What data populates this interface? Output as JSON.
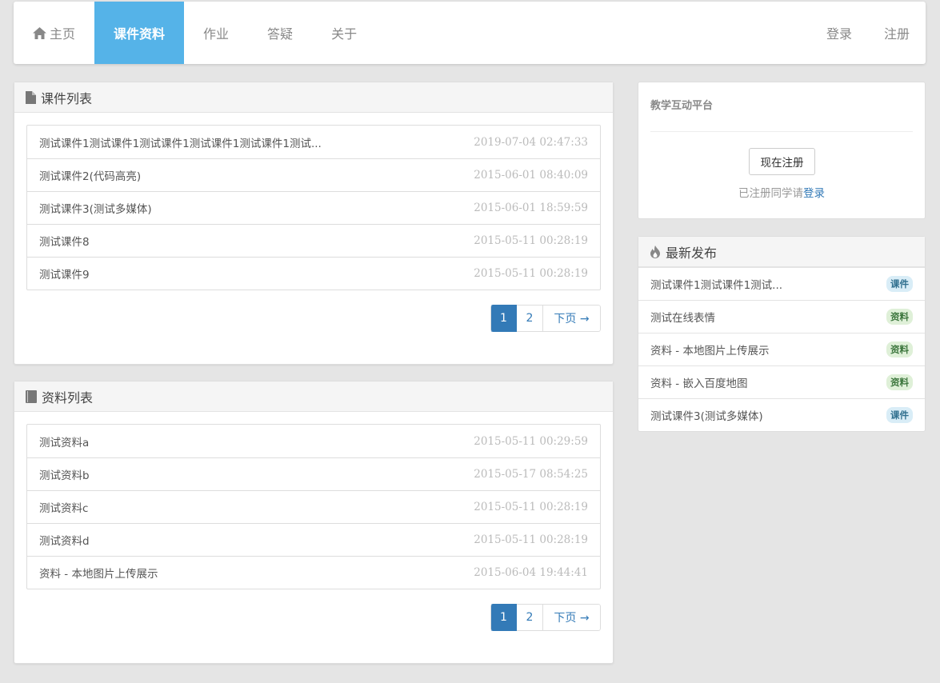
{
  "nav": {
    "items": [
      {
        "label": "主页",
        "icon": "home-icon"
      },
      {
        "label": "课件资料"
      },
      {
        "label": "作业"
      },
      {
        "label": "答疑"
      },
      {
        "label": "关于"
      }
    ],
    "right": [
      {
        "label": "登录"
      },
      {
        "label": "注册"
      }
    ],
    "active_color": "#55b3e8"
  },
  "courseware": {
    "title": "课件列表",
    "icon": "file-icon",
    "rows": [
      {
        "title": "测试课件1测试课件1测试课件1测试课件1测试课件1测试...",
        "date": "2019-07-04 02:47:33"
      },
      {
        "title": "测试课件2(代码高亮)",
        "date": "2015-06-01 08:40:09"
      },
      {
        "title": "测试课件3(测试多媒体)",
        "date": "2015-06-01 18:59:59"
      },
      {
        "title": "测试课件8",
        "date": "2015-05-11 00:28:19"
      },
      {
        "title": "测试课件9",
        "date": "2015-05-11 00:28:19"
      }
    ],
    "pager": {
      "p1": "1",
      "p2": "2",
      "next": "下页 →"
    }
  },
  "materials": {
    "title": "资料列表",
    "icon": "book-icon",
    "rows": [
      {
        "title": "测试资料a",
        "date": "2015-05-11 00:29:59"
      },
      {
        "title": "测试资料b",
        "date": "2015-05-17 08:54:25"
      },
      {
        "title": "测试资料c",
        "date": "2015-05-11 00:28:19"
      },
      {
        "title": "测试资料d",
        "date": "2015-05-11 00:28:19"
      },
      {
        "title": "资料 - 本地图片上传展示",
        "date": "2015-06-04 19:44:41"
      }
    ],
    "pager": {
      "p1": "1",
      "p2": "2",
      "next": "下页 →"
    }
  },
  "sidebar": {
    "brand": "教学互动平台",
    "register_button": "现在注册",
    "hint_text": "已注册同学请",
    "hint_link": "登录"
  },
  "latest": {
    "title": "最新发布",
    "icon": "fire-icon",
    "rows": [
      {
        "title": "测试课件1测试课件1测试...",
        "badge": "课件"
      },
      {
        "title": "测试在线表情",
        "badge": "资料"
      },
      {
        "title": "资料 - 本地图片上传展示",
        "badge": "资料"
      },
      {
        "title": "资料 - 嵌入百度地图",
        "badge": "资料"
      },
      {
        "title": "测试课件3(测试多媒体)",
        "badge": "课件"
      }
    ]
  }
}
